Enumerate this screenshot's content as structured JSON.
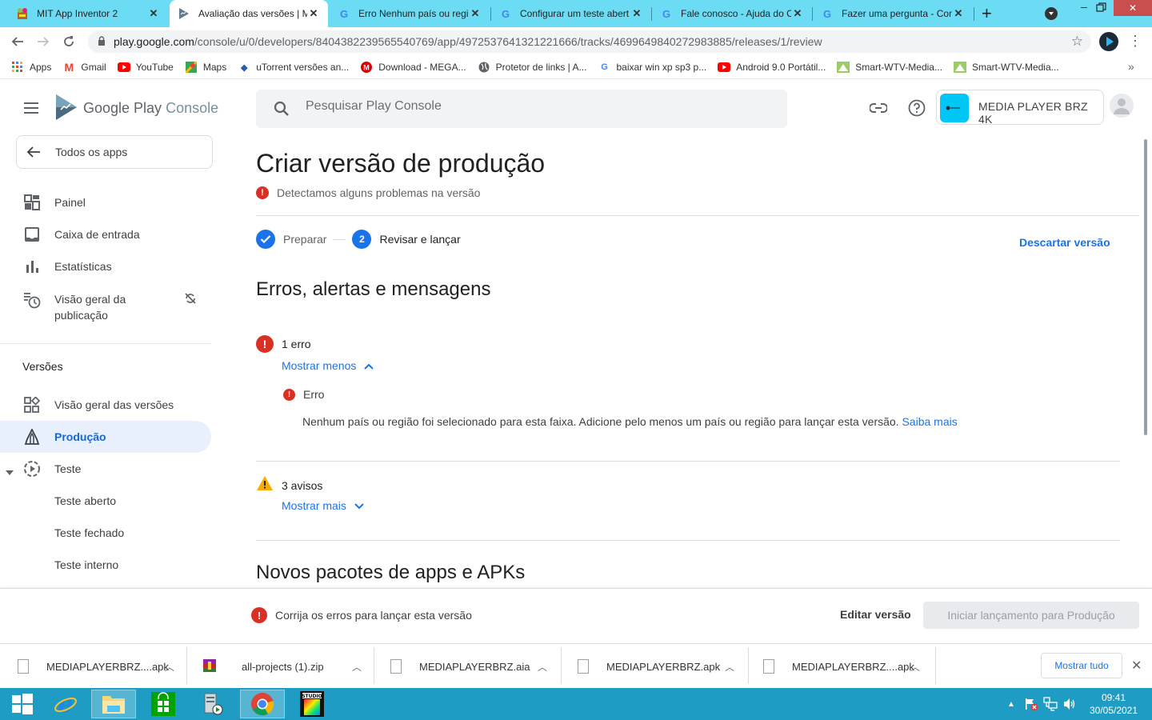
{
  "browser": {
    "tabs": [
      {
        "title": "MIT App Inventor 2",
        "favicon": "app-inventor-icon",
        "active": false
      },
      {
        "title": "Avaliação das versões | MI",
        "favicon": "play-console-icon",
        "active": true
      },
      {
        "title": "Erro Nenhum país ou regi",
        "favicon": "google-icon",
        "active": false
      },
      {
        "title": "Configurar um teste abert",
        "favicon": "google-icon",
        "active": false
      },
      {
        "title": "Fale conosco - Ajuda do C",
        "favicon": "google-icon",
        "active": false
      },
      {
        "title": "Fazer uma pergunta - Con",
        "favicon": "google-icon",
        "active": false
      }
    ],
    "new_tab_label": "+",
    "address": {
      "host": "play.google.com",
      "path": "/console/u/0/developers/8404382239565540769/app/4972537641321221666/tracks/4699649840272983885/releases/1/review"
    },
    "bookmarks": [
      {
        "label": "Apps",
        "icon": "apps-grid-icon"
      },
      {
        "label": "Gmail",
        "icon": "gmail-icon"
      },
      {
        "label": "YouTube",
        "icon": "youtube-icon"
      },
      {
        "label": "Maps",
        "icon": "maps-icon"
      },
      {
        "label": "uTorrent versões an...",
        "icon": "utorrent-icon"
      },
      {
        "label": "Download - MEGA...",
        "icon": "mega-icon"
      },
      {
        "label": "Protetor de links | A...",
        "icon": "globe-icon"
      },
      {
        "label": "baixar win xp sp3 p...",
        "icon": "google-icon"
      },
      {
        "label": "Android 9.0 Portátil...",
        "icon": "youtube-icon"
      },
      {
        "label": "Smart-WTV-Media...",
        "icon": "smart-wtv-icon"
      },
      {
        "label": "Smart-WTV-Media...",
        "icon": "smart-wtv-icon"
      }
    ],
    "more_bookmarks": "»"
  },
  "console": {
    "logo_text_1": "Google Play",
    "logo_text_2": "Console",
    "back_label": "Todos os apps",
    "search_placeholder": "Pesquisar Play Console",
    "app_name": "MEDIA PLAYER BRZ 4K",
    "sidebar": {
      "items": [
        {
          "label": "Painel",
          "icon": "dashboard-icon"
        },
        {
          "label": "Caixa de entrada",
          "icon": "inbox-icon"
        },
        {
          "label": "Estatísticas",
          "icon": "bar-chart-icon"
        },
        {
          "label": "Visão geral da publicação",
          "icon": "publishing-overview-icon"
        }
      ],
      "section_title": "Versões",
      "release_items": [
        {
          "label": "Visão geral das versões",
          "icon": "releases-overview-icon",
          "active": false
        },
        {
          "label": "Produção",
          "icon": "production-icon",
          "active": true
        },
        {
          "label": "Teste",
          "icon": "testing-icon",
          "active": false
        },
        {
          "label": "Teste aberto",
          "active": false
        },
        {
          "label": "Teste fechado",
          "active": false
        },
        {
          "label": "Teste interno",
          "active": false
        }
      ]
    },
    "page": {
      "title": "Criar versão de produção",
      "problem_notice": "Detectamos alguns problemas na versão",
      "steps": [
        {
          "number": "1",
          "label": "Preparar",
          "state": "done"
        },
        {
          "number": "2",
          "label": "Revisar e lançar",
          "state": "current"
        }
      ],
      "discard_label": "Descartar versão",
      "section_title": "Erros, alertas e mensagens",
      "errors": {
        "count_label": "1 erro",
        "toggle_label": "Mostrar menos",
        "items": [
          {
            "title": "Erro",
            "message": "Nenhum país ou região foi selecionado para esta faixa. Adicione pelo menos um país ou região para lançar esta versão.",
            "link": "Saiba mais"
          }
        ]
      },
      "warnings": {
        "count_label": "3 avisos",
        "toggle_label": "Mostrar mais"
      },
      "next_section_title": "Novos pacotes de apps e APKs"
    },
    "action_bar": {
      "message": "Corrija os erros para lançar esta versão",
      "edit_label": "Editar versão",
      "launch_label": "Iniciar lançamento para Produção"
    }
  },
  "downloads": {
    "items": [
      {
        "name": "MEDIAPLAYERBRZ....apk",
        "icon": "file-icon"
      },
      {
        "name": "all-projects (1).zip",
        "icon": "winrar-icon"
      },
      {
        "name": "MEDIAPLAYERBRZ.aia",
        "icon": "file-icon"
      },
      {
        "name": "MEDIAPLAYERBRZ.apk",
        "icon": "file-icon"
      },
      {
        "name": "MEDIAPLAYERBRZ....apk",
        "icon": "file-icon"
      }
    ],
    "show_all_label": "Mostrar tudo"
  },
  "taskbar": {
    "time": "09:41",
    "date": "30/05/2021"
  },
  "colors": {
    "accent": "#1a73e8",
    "error": "#d93025",
    "warning": "#f9ab00",
    "tabstrip": "#6cdcf5",
    "taskbar": "#1e9cc3"
  }
}
